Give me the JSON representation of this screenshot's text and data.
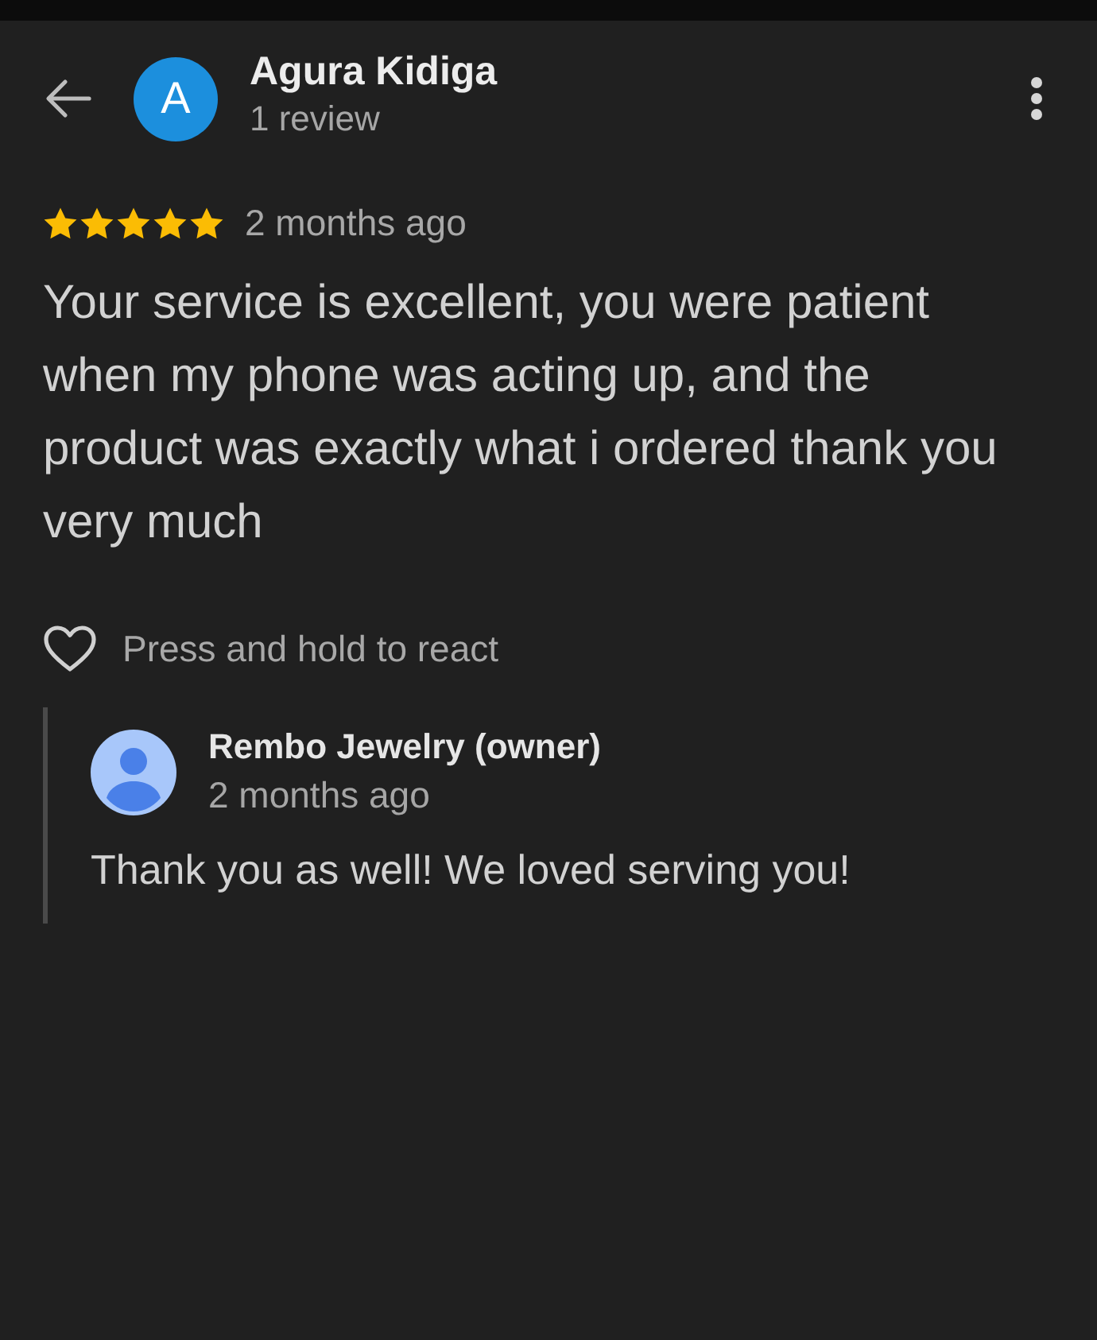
{
  "header": {
    "avatar_letter": "A",
    "name": "Agura Kidiga",
    "subtitle": "1 review"
  },
  "review": {
    "stars": 5,
    "time": "2 months ago",
    "text": "Your service is excellent, you were patient when my phone was acting up, and the product was exactly what i ordered thank you very much"
  },
  "reaction": {
    "label": "Press and hold to react"
  },
  "reply": {
    "author": "Rembo Jewelry (owner)",
    "time": "2 months ago",
    "text": "Thank you as well! We loved serving you!"
  }
}
